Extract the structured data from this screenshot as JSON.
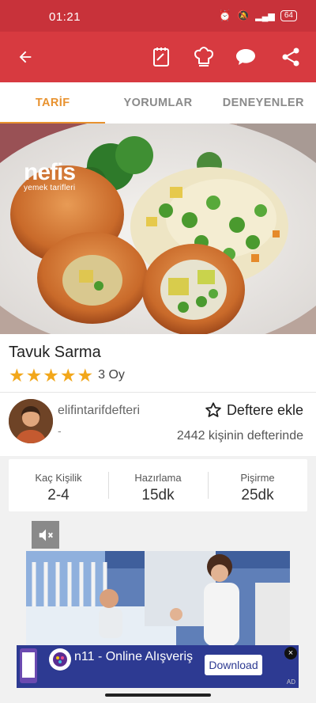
{
  "status": {
    "time": "01:21",
    "battery": "64"
  },
  "tabs": [
    {
      "label": "TARİF",
      "active": true
    },
    {
      "label": "YORUMLAR",
      "active": false
    },
    {
      "label": "DENEYENLER",
      "active": false
    }
  ],
  "hero": {
    "logo_brand": "nefis",
    "logo_sub": "yemek tarifleri"
  },
  "recipe": {
    "title": "Tavuk Sarma",
    "rating": 5,
    "votes": "3 Oy",
    "author": "elifintarifdefteri",
    "author_sub": "-",
    "add_label": "Deftere ekle",
    "saved_count": "2442 kişinin defterinde"
  },
  "stats": [
    {
      "label": "Kaç Kişilik",
      "value": "2-4"
    },
    {
      "label": "Hazırlama",
      "value": "15dk"
    },
    {
      "label": "Pişirme",
      "value": "25dk"
    }
  ],
  "ad": {
    "title": "n11 - Online Alışveriş",
    "button": "Download",
    "close": "×",
    "label": "AD"
  },
  "colors": {
    "primary": "#d73a40",
    "accent": "#e8922f",
    "star": "#f2a71b",
    "ad_bg": "#2d3a92"
  }
}
